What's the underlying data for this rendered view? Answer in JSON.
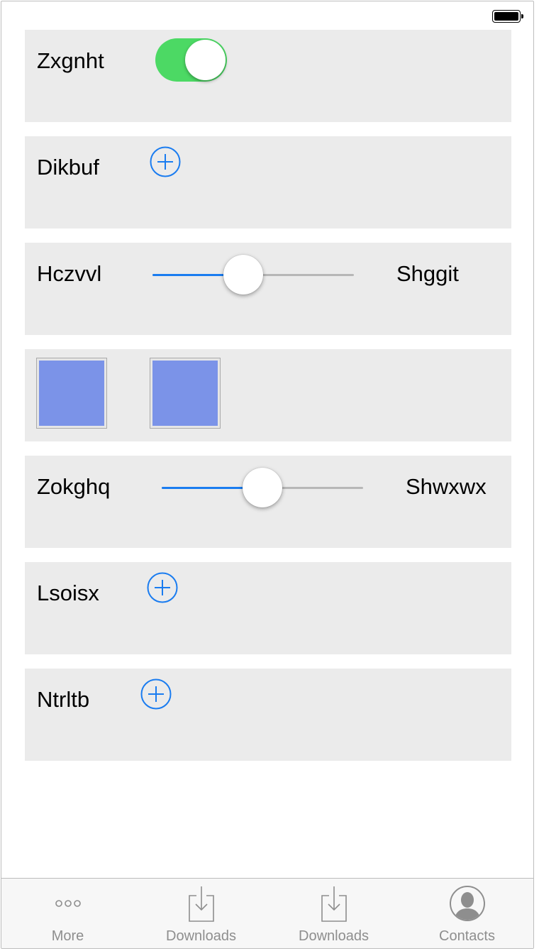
{
  "colors": {
    "row_bg": "#ebebeb",
    "toggle_on": "#4cd964",
    "accent": "#1a7cf0",
    "swatch": "#7b93e8",
    "tab_label": "#8e8e8e"
  },
  "rows": {
    "toggle_row": {
      "label": "Zxgnht",
      "on": true
    },
    "add_row_1": {
      "label": "Dikbuf",
      "icon": "plus-circle-icon"
    },
    "slider_row_1": {
      "label": "Hczvvl",
      "value_label": "Shggit",
      "fraction": 0.45
    },
    "swatch_row": {
      "swatches": [
        "#7b93e8",
        "#7b93e8"
      ]
    },
    "slider_row_2": {
      "label": "Zokghq",
      "value_label": "Shwxwx",
      "fraction": 0.5
    },
    "add_row_2": {
      "label": "Lsoisx",
      "icon": "plus-circle-icon"
    },
    "add_row_3": {
      "label": "Ntrltb",
      "icon": "plus-circle-icon"
    }
  },
  "tabbar": {
    "tabs": [
      {
        "label": "More",
        "icon": "more-dots-icon"
      },
      {
        "label": "Downloads",
        "icon": "download-icon"
      },
      {
        "label": "Downloads",
        "icon": "download-icon"
      },
      {
        "label": "Contacts",
        "icon": "contact-avatar-icon"
      }
    ]
  }
}
